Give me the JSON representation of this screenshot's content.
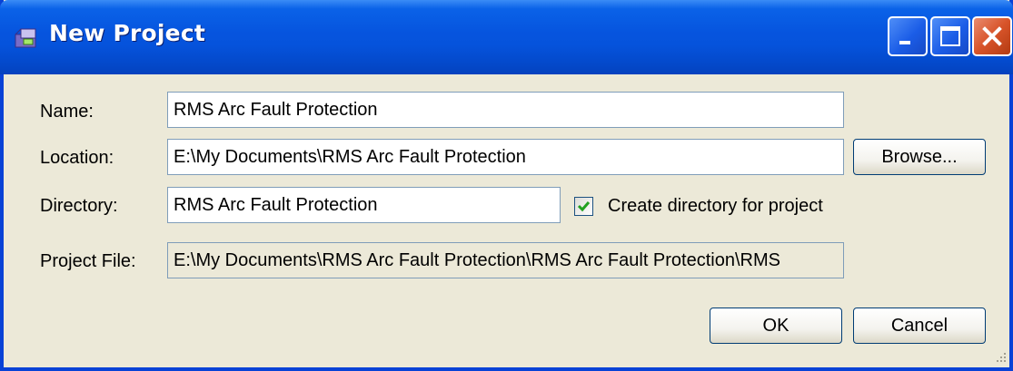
{
  "window": {
    "title": "New Project",
    "minimize_icon": "minimize-icon",
    "maximize_icon": "maximize-icon",
    "close_icon": "close-icon"
  },
  "form": {
    "name_label": "Name:",
    "name_value": "RMS Arc Fault Protection",
    "location_label": "Location:",
    "location_value": "E:\\My Documents\\RMS Arc Fault Protection",
    "browse_label": "Browse...",
    "directory_label": "Directory:",
    "directory_value": "RMS Arc Fault Protection",
    "create_dir_label": "Create directory for project",
    "create_dir_checked": true,
    "project_file_label": "Project File:",
    "project_file_value": "E:\\My Documents\\RMS Arc Fault Protection\\RMS Arc Fault Protection\\RMS"
  },
  "buttons": {
    "ok": "OK",
    "cancel": "Cancel"
  },
  "colors": {
    "titlebar": "#0654de",
    "dialog_bg": "#ece9d8",
    "close_button": "#d8542a",
    "checkmark": "#21a121"
  }
}
